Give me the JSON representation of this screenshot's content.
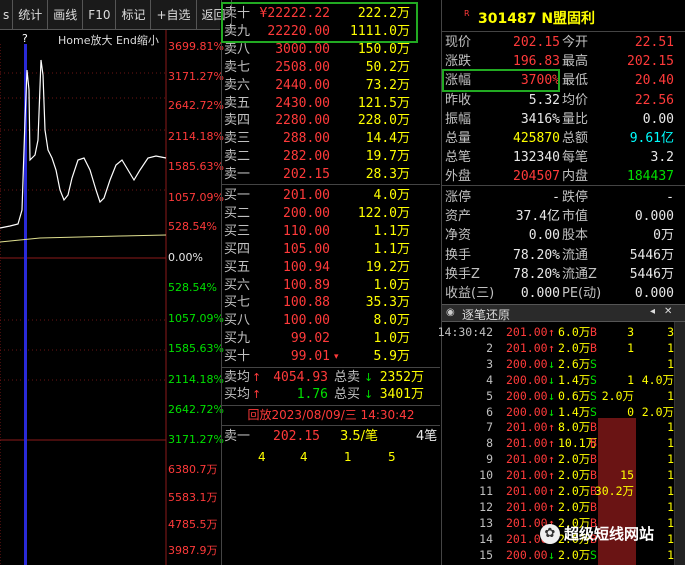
{
  "toolbar": {
    "items": [
      "s",
      "统计",
      "画线",
      "F10",
      "标记",
      "+自选",
      "返回"
    ]
  },
  "chart": {
    "help_mark": "?",
    "hint": "Home放大 End缩小",
    "upper_pct": [
      "3699.81%",
      "3171.27%",
      "2642.72%",
      "2114.18%",
      "1585.63%",
      "1057.09%",
      "528.54%"
    ],
    "zero_pct": "0.00%",
    "lower_pct": [
      "528.54%",
      "1057.09%",
      "1585.63%",
      "2114.18%",
      "2642.72%",
      "3171.27%"
    ],
    "vol_labels": [
      "6380.7万",
      "5583.1万",
      "4785.5万",
      "3987.9万"
    ]
  },
  "book": {
    "asks": [
      {
        "label": "卖十",
        "price": "¥22222.22",
        "vol": "222.2万"
      },
      {
        "label": "卖九",
        "price": "22220.00",
        "vol": "1111.0万"
      },
      {
        "label": "卖八",
        "price": "3000.00",
        "vol": "150.0万"
      },
      {
        "label": "卖七",
        "price": "2508.00",
        "vol": "50.2万"
      },
      {
        "label": "卖六",
        "price": "2440.00",
        "vol": "73.2万"
      },
      {
        "label": "卖五",
        "price": "2430.00",
        "vol": "121.5万"
      },
      {
        "label": "卖四",
        "price": "2280.00",
        "vol": "228.0万"
      },
      {
        "label": "卖三",
        "price": "288.00",
        "vol": "14.4万"
      },
      {
        "label": "卖二",
        "price": "282.00",
        "vol": "19.7万"
      },
      {
        "label": "卖一",
        "price": "202.15",
        "vol": "28.3万"
      }
    ],
    "bids": [
      {
        "label": "买一",
        "price": "201.00",
        "vol": "4.0万"
      },
      {
        "label": "买二",
        "price": "200.00",
        "vol": "122.0万"
      },
      {
        "label": "买三",
        "price": "110.00",
        "vol": "1.1万"
      },
      {
        "label": "买四",
        "price": "105.00",
        "vol": "1.1万"
      },
      {
        "label": "买五",
        "price": "100.94",
        "vol": "19.2万"
      },
      {
        "label": "买六",
        "price": "100.89",
        "vol": "1.0万"
      },
      {
        "label": "买七",
        "price": "100.88",
        "vol": "35.3万"
      },
      {
        "label": "买八",
        "price": "100.00",
        "vol": "8.0万"
      },
      {
        "label": "买九",
        "price": "99.02",
        "vol": "1.0万"
      },
      {
        "label": "买十",
        "price": "99.01",
        "vol": "5.9万"
      }
    ],
    "ask_avg": {
      "label": "卖均",
      "value": "4054.93",
      "total_label": "总卖",
      "total": "2352万"
    },
    "bid_avg": {
      "label": "买均",
      "value": "1.76",
      "total_label": "总买",
      "total": "3401万"
    },
    "replay": "回放2023/08/09/三  14:30:42",
    "sell_one": {
      "label": "卖一",
      "price": "202.15",
      "qty": "3.5/笔",
      "count": "4笔"
    },
    "queue": [
      "4",
      "4",
      "1",
      "5"
    ]
  },
  "quote": {
    "r_mark": "R",
    "code_name": "301487 N盟固利",
    "rows": [
      {
        "l1": "现价",
        "v1": "202.15",
        "l2": "今开",
        "v2": "22.51"
      },
      {
        "l1": "涨跌",
        "v1": "196.83",
        "l2": "最高",
        "v2": "202.15"
      },
      {
        "l1": "涨幅",
        "v1": "3700%",
        "l2": "最低",
        "v2": "20.40"
      },
      {
        "l1": "昨收",
        "v1": "5.32",
        "l2": "均价",
        "v2": "22.56"
      },
      {
        "l1": "振幅",
        "v1": "3416%",
        "l2": "量比",
        "v2": "0.00"
      },
      {
        "l1": "总量",
        "v1": "425870",
        "l2": "总额",
        "v2": "9.61亿"
      },
      {
        "l1": "总笔",
        "v1": "132340",
        "l2": "每笔",
        "v2": "3.2"
      },
      {
        "l1": "外盘",
        "v1": "204507",
        "l2": "内盘",
        "v2": "184437"
      }
    ],
    "rows2": [
      {
        "l1": "涨停",
        "v1": "-",
        "l2": "跌停",
        "v2": "-"
      },
      {
        "l1": "资产",
        "v1": "37.4亿",
        "l2": "市值",
        "v2": "0.000"
      },
      {
        "l1": "净资",
        "v1": "0.00",
        "l2": "股本",
        "v2": "0万"
      },
      {
        "l1": "换手",
        "v1": "78.20%",
        "l2": "流通",
        "v2": "5446万"
      },
      {
        "l1": "换手Z",
        "v1": "78.20%",
        "l2": "流通Z",
        "v2": "5446万"
      },
      {
        "l1": "收益(三)",
        "v1": "0.000",
        "l2": "PE(动)",
        "v2": "0.000"
      }
    ],
    "tick_header": "逐笔还原",
    "ticks": [
      {
        "t": "14:30:42",
        "p": "201.00",
        "v": "6.0万",
        "d": "B",
        "o1": "3",
        "o2": "3"
      },
      {
        "t": "2",
        "p": "201.00",
        "v": "2.0万",
        "d": "B",
        "o1": "1",
        "o2": "1"
      },
      {
        "t": "3",
        "p": "200.00",
        "v": "2.6万",
        "d": "S",
        "o1": "",
        "o2": "1"
      },
      {
        "t": "4",
        "p": "200.00",
        "v": "1.4万",
        "d": "S",
        "o1": "1",
        "o2": "4.0万"
      },
      {
        "t": "5",
        "p": "200.00",
        "v": "0.6万",
        "d": "S",
        "o1": "2.0万",
        "o2": "1"
      },
      {
        "t": "6",
        "p": "200.00",
        "v": "1.4万",
        "d": "S",
        "o1": "0",
        "o2": "2.0万"
      },
      {
        "t": "7",
        "p": "201.00",
        "v": "8.0万",
        "d": "B",
        "o1": "",
        "o2": "1"
      },
      {
        "t": "8",
        "p": "201.00",
        "v": "10.1万",
        "d": "B",
        "o1": "",
        "o2": "1"
      },
      {
        "t": "9",
        "p": "201.00",
        "v": "2.0万",
        "d": "B",
        "o1": "",
        "o2": "1"
      },
      {
        "t": "10",
        "p": "201.00",
        "v": "2.0万",
        "d": "B",
        "o1": "15",
        "o2": "1"
      },
      {
        "t": "11",
        "p": "201.00",
        "v": "2.0万",
        "d": "B",
        "o1": "30.2万",
        "o2": "1"
      },
      {
        "t": "12",
        "p": "201.00",
        "v": "2.0万",
        "d": "B",
        "o1": "",
        "o2": "1"
      },
      {
        "t": "13",
        "p": "201.00",
        "v": "2.0万",
        "d": "B",
        "o1": "",
        "o2": "1"
      },
      {
        "t": "14",
        "p": "201.00",
        "v": "2.0万",
        "d": "B",
        "o1": "",
        "o2": "1"
      },
      {
        "t": "15",
        "p": "200.00",
        "v": "2.0万",
        "d": "S",
        "o1": "",
        "o2": "1"
      }
    ],
    "watermark": "超级短线网站"
  },
  "colors": {
    "up": "#ff3a3a",
    "down": "#00e000",
    "accent": "#ffff00",
    "box": "#22aa22"
  }
}
